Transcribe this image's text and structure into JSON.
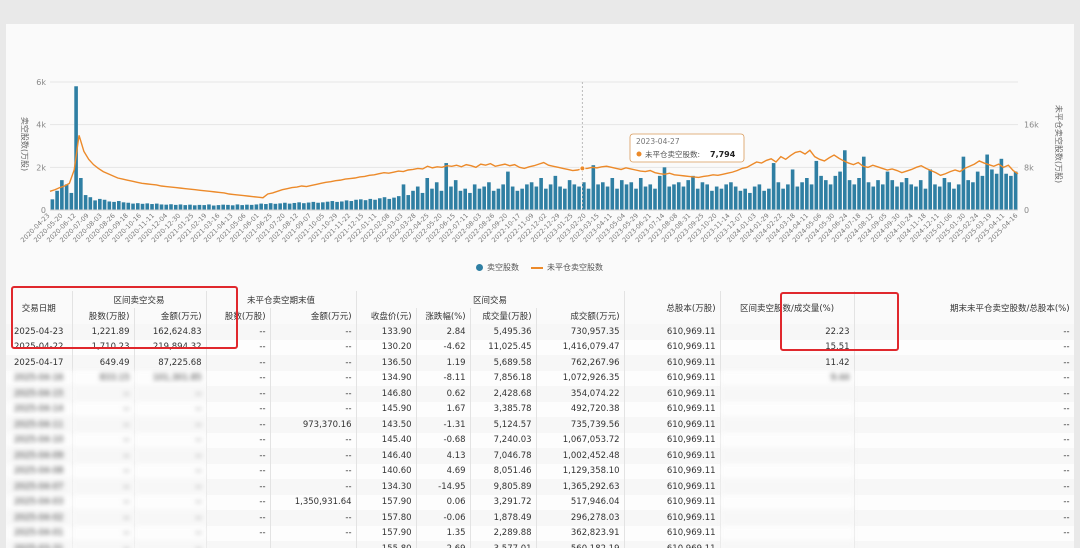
{
  "chart_data": {
    "type": "bar+line",
    "left_axis_label": "卖空股数(万股)",
    "right_axis_label": "未平仓卖空股数(万股)",
    "left_ticks": [
      "0",
      "2k",
      "4k",
      "6k"
    ],
    "right_ticks": [
      "0",
      "8k",
      "16k"
    ],
    "ylim_left": [
      0,
      6000
    ],
    "ylim_right": [
      0,
      24000
    ],
    "x_tick_labels": [
      "2020-04-23",
      "2020-05-20",
      "2020-06-12",
      "2020-07-09",
      "2020-08-03",
      "2020-08-26",
      "2020-09-18",
      "2020-10-16",
      "2020-11-11",
      "2020-12-04",
      "2020-12-30",
      "2021-01-25",
      "2021-02-19",
      "2021-03-16",
      "2021-04-13",
      "2021-05-06",
      "2021-06-01",
      "2021-06-25",
      "2021-07-20",
      "2021-08-12",
      "2021-09-07",
      "2021-10-05",
      "2021-10-29",
      "2021-11-22",
      "2021-12-15",
      "2022-01-11",
      "2022-02-08",
      "2022-03-03",
      "2022-03-28",
      "2022-04-25",
      "2022-05-20",
      "2022-06-15",
      "2022-07-11",
      "2022-08-03",
      "2022-08-26",
      "2022-09-20",
      "2022-10-17",
      "2022-11-09",
      "2022-12-02",
      "2022-12-29",
      "2023-01-25",
      "2023-02-20",
      "2023-03-15",
      "2023-04-11",
      "2023-05-04",
      "2023-05-29",
      "2023-06-21",
      "2023-07-14",
      "2023-08-08",
      "2023-08-31",
      "2023-09-25",
      "2023-10-20",
      "2023-11-14",
      "2023-12-07",
      "2024-01-03",
      "2024-01-29",
      "2024-02-22",
      "2024-03-18",
      "2024-04-11",
      "2024-05-06",
      "2024-05-30",
      "2024-06-24",
      "2024-07-18",
      "2024-08-12",
      "2024-09-05",
      "2024-09-30",
      "2024-10-24",
      "2024-11-18",
      "2024-12-11",
      "2025-01-06",
      "2025-01-30",
      "2025-02-24",
      "2025-03-19",
      "2025-04-11",
      "2025-04-16"
    ],
    "series": [
      {
        "name": "卖空股数",
        "axis": "left",
        "color": "#2f7fa3",
        "values": [
          500,
          900,
          1400,
          1200,
          800,
          5800,
          1500,
          700,
          600,
          450,
          520,
          480,
          400,
          380,
          420,
          360,
          340,
          300,
          320,
          290,
          310,
          280,
          300,
          260,
          250,
          270,
          240,
          260,
          230,
          250,
          220,
          240,
          230,
          260,
          210,
          230,
          250,
          240,
          220,
          260,
          230,
          250,
          240,
          260,
          300,
          280,
          320,
          290,
          310,
          340,
          300,
          330,
          360,
          320,
          350,
          380,
          340,
          360,
          390,
          420,
          380,
          400,
          450,
          420,
          480,
          500,
          460,
          520,
          480,
          550,
          600,
          520,
          580,
          650,
          1200,
          700,
          900,
          1100,
          800,
          1500,
          1000,
          1300,
          900,
          2200,
          1100,
          1400,
          900,
          1000,
          800,
          1200,
          1000,
          1100,
          1300,
          900,
          1000,
          1200,
          1800,
          1100,
          900,
          1000,
          1200,
          1300,
          1100,
          1500,
          1000,
          1200,
          1600,
          1100,
          1000,
          1400,
          1200,
          1100,
          1300,
          1000,
          2100,
          1200,
          1300,
          1100,
          1500,
          1000,
          1400,
          1200,
          1300,
          1000,
          1500,
          1100,
          1200,
          1000,
          1600,
          2000,
          1100,
          1200,
          1300,
          1100,
          1400,
          1600,
          1000,
          1300,
          1200,
          900,
          1100,
          1000,
          1200,
          1300,
          1100,
          900,
          1000,
          800,
          1100,
          1200,
          900,
          1000,
          2200,
          1300,
          1000,
          1200,
          1900,
          1100,
          1300,
          1500,
          1200,
          2300,
          1600,
          1400,
          1200,
          1600,
          1800,
          2800,
          1400,
          1200,
          1500,
          2500,
          1300,
          1100,
          1400,
          1200,
          1800,
          1400,
          1100,
          1300,
          1500,
          1200,
          1100,
          1400,
          1000,
          1900,
          1200,
          1100,
          1500,
          1300,
          1000,
          1200,
          2500,
          1400,
          1300,
          1800,
          1600,
          2600,
          1900,
          1700,
          2400,
          1700,
          1600,
          1800
        ]
      },
      {
        "name": "未平仓卖空股数",
        "axis": "right",
        "color": "#ec8a2a",
        "values": [
          3500,
          3800,
          4200,
          4500,
          5000,
          7500,
          14000,
          11000,
          9500,
          8500,
          7800,
          7200,
          6800,
          6400,
          6000,
          5800,
          5600,
          5400,
          5200,
          5000,
          4900,
          4800,
          4700,
          4500,
          4400,
          4300,
          4200,
          4100,
          4000,
          3900,
          3800,
          3700,
          3600,
          3500,
          3400,
          3300,
          3200,
          3000,
          2900,
          2800,
          2700,
          2600,
          2500,
          2400,
          2300,
          3000,
          3200,
          3500,
          3800,
          4000,
          4200,
          4300,
          4500,
          4400,
          4600,
          4800,
          5000,
          5200,
          5300,
          5500,
          5600,
          5800,
          5900,
          6000,
          6200,
          6300,
          6500,
          6600,
          6800,
          7000,
          6900,
          7100,
          7300,
          7200,
          7500,
          7600,
          7800,
          7700,
          8200,
          7900,
          8100,
          8000,
          8300,
          8200,
          8400,
          8100,
          8500,
          8300,
          8000,
          8600,
          8400,
          8700,
          8200,
          8400,
          8600,
          8300,
          8500,
          8000,
          7800,
          8100,
          8300,
          8600,
          8900,
          8400,
          8200,
          8000,
          7800,
          7600,
          7400,
          7500,
          7794,
          7800,
          8000,
          7900,
          8100,
          8200,
          8000,
          7800,
          7600,
          7900,
          7700,
          7500,
          7300,
          7200,
          7400,
          7000,
          6800,
          6700,
          6900,
          6600,
          6500,
          6400,
          6300,
          6200,
          6100,
          6300,
          6400,
          6600,
          6500,
          6700,
          6900,
          7100,
          7400,
          7800,
          8000,
          8500,
          9000,
          8800,
          9300,
          9600,
          9000,
          10000,
          9500,
          10200,
          10800,
          11000,
          10500,
          11200,
          10000,
          9500,
          9200,
          9800,
          10300,
          9700,
          9200,
          8800,
          8500,
          8900,
          8200,
          8000,
          8400,
          8100,
          7800,
          7500,
          7700,
          7400,
          7000,
          7300,
          7600,
          8000,
          8300,
          7800,
          7400,
          7000,
          6500,
          6800,
          7200,
          7500,
          7200,
          7800,
          8200,
          8600,
          9200,
          8800,
          8500,
          8200,
          8600,
          8000,
          8400,
          7400,
          6800
        ]
      }
    ],
    "tooltip": {
      "date": "2023-04-27",
      "label": "未平仓卖空股数:",
      "value": "7,794"
    },
    "legend": {
      "position": "bottom-center"
    }
  },
  "table": {
    "group_headers": {
      "date": "交易日期",
      "range_short": "区间卖空交易",
      "unclosed": "未平仓卖空期末值",
      "range_trade": "区间交易",
      "total_capital": "总股本(万股)",
      "ratio": "区间卖空股数/成交量(%)",
      "ratio2": "期末未平仓卖空股数/总股本(%)"
    },
    "sub_headers": {
      "shares": "股数(万股)",
      "amount": "金额(万元)",
      "u_shares": "股数(万股)",
      "u_amount": "金额(万元)",
      "close": "收盘价(元)",
      "change": "涨跌幅(%)",
      "volume": "成交量(万股)",
      "turnover": "成交额(万元)"
    },
    "rows": [
      {
        "date": "2025-04-23",
        "shares": "1,221.89",
        "amount": "162,624.83",
        "u_shares": "--",
        "u_amount": "--",
        "close": "133.90",
        "change": "2.84",
        "volume": "5,495.36",
        "turnover": "730,957.35",
        "total": "610,969.11",
        "ratio": "22.23",
        "ratio2": "--"
      },
      {
        "date": "2025-04-22",
        "shares": "1,710.23",
        "amount": "219,894.32",
        "u_shares": "--",
        "u_amount": "--",
        "close": "130.20",
        "change": "-4.62",
        "volume": "11,025.45",
        "turnover": "1,416,079.47",
        "total": "610,969.11",
        "ratio": "15.51",
        "ratio2": "--"
      },
      {
        "date": "2025-04-17",
        "shares": "649.49",
        "amount": "87,225.68",
        "u_shares": "--",
        "u_amount": "--",
        "close": "136.50",
        "change": "1.19",
        "volume": "5,689.58",
        "turnover": "762,267.96",
        "total": "610,969.11",
        "ratio": "11.42",
        "ratio2": "--"
      },
      {
        "date": "2025-04-16",
        "shares": "833.15",
        "amount": "101,301.85",
        "u_shares": "--",
        "u_amount": "--",
        "close": "134.90",
        "change": "-8.11",
        "volume": "7,856.18",
        "turnover": "1,072,926.35",
        "total": "610,969.11",
        "ratio": "9.44",
        "ratio2": "--"
      },
      {
        "date": "2025-04-15",
        "shares": "--",
        "amount": "--",
        "u_shares": "--",
        "u_amount": "--",
        "close": "146.80",
        "change": "0.62",
        "volume": "2,428.68",
        "turnover": "354,074.22",
        "total": "610,969.11",
        "ratio": "",
        "ratio2": "--"
      },
      {
        "date": "2025-04-14",
        "shares": "--",
        "amount": "--",
        "u_shares": "--",
        "u_amount": "--",
        "close": "145.90",
        "change": "1.67",
        "volume": "3,385.78",
        "turnover": "492,720.38",
        "total": "610,969.11",
        "ratio": "",
        "ratio2": "--"
      },
      {
        "date": "2025-04-11",
        "shares": "--",
        "amount": "--",
        "u_shares": "--",
        "u_amount": "973,370.16",
        "close": "143.50",
        "change": "-1.31",
        "volume": "5,124.57",
        "turnover": "735,739.56",
        "total": "610,969.11",
        "ratio": "",
        "ratio2": "--"
      },
      {
        "date": "2025-04-10",
        "shares": "--",
        "amount": "--",
        "u_shares": "--",
        "u_amount": "--",
        "close": "145.40",
        "change": "-0.68",
        "volume": "7,240.03",
        "turnover": "1,067,053.72",
        "total": "610,969.11",
        "ratio": "",
        "ratio2": "--"
      },
      {
        "date": "2025-04-09",
        "shares": "--",
        "amount": "--",
        "u_shares": "--",
        "u_amount": "--",
        "close": "146.40",
        "change": "4.13",
        "volume": "7,046.78",
        "turnover": "1,002,452.48",
        "total": "610,969.11",
        "ratio": "",
        "ratio2": "--"
      },
      {
        "date": "2025-04-08",
        "shares": "--",
        "amount": "--",
        "u_shares": "--",
        "u_amount": "--",
        "close": "140.60",
        "change": "4.69",
        "volume": "8,051.46",
        "turnover": "1,129,358.10",
        "total": "610,969.11",
        "ratio": "",
        "ratio2": "--"
      },
      {
        "date": "2025-04-07",
        "shares": "--",
        "amount": "--",
        "u_shares": "--",
        "u_amount": "--",
        "close": "134.30",
        "change": "-14.95",
        "volume": "9,805.89",
        "turnover": "1,365,292.63",
        "total": "610,969.11",
        "ratio": "",
        "ratio2": "--"
      },
      {
        "date": "2025-04-03",
        "shares": "--",
        "amount": "--",
        "u_shares": "--",
        "u_amount": "1,350,931.64",
        "close": "157.90",
        "change": "0.06",
        "volume": "3,291.72",
        "turnover": "517,946.04",
        "total": "610,969.11",
        "ratio": "",
        "ratio2": "--"
      },
      {
        "date": "2025-04-02",
        "shares": "--",
        "amount": "--",
        "u_shares": "--",
        "u_amount": "--",
        "close": "157.80",
        "change": "-0.06",
        "volume": "1,878.49",
        "turnover": "296,278.03",
        "total": "610,969.11",
        "ratio": "",
        "ratio2": "--"
      },
      {
        "date": "2025-04-01",
        "shares": "--",
        "amount": "--",
        "u_shares": "--",
        "u_amount": "--",
        "close": "157.90",
        "change": "1.35",
        "volume": "2,289.88",
        "turnover": "362,823.91",
        "total": "610,969.11",
        "ratio": "",
        "ratio2": "--"
      },
      {
        "date": "2025-03-31",
        "shares": "--",
        "amount": "--",
        "u_shares": "--",
        "u_amount": "--",
        "close": "155.80",
        "change": "-2.69",
        "volume": "3,577.01",
        "turnover": "560,182.19",
        "total": "610,969.11",
        "ratio": "",
        "ratio2": "--"
      }
    ]
  }
}
